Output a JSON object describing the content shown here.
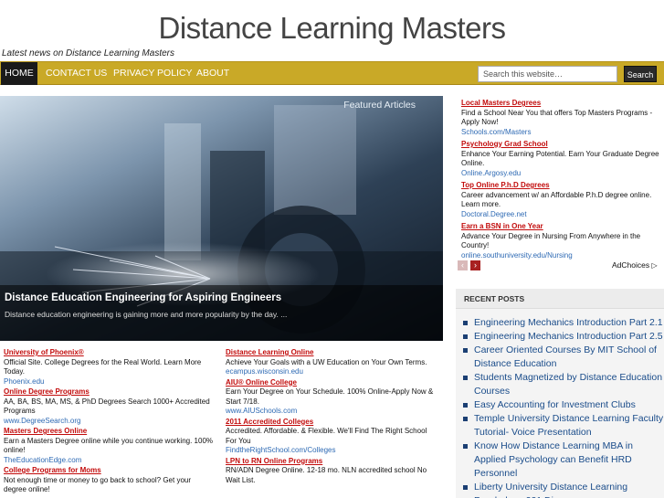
{
  "site": {
    "title": "Distance Learning Masters",
    "tagline": "Latest news on Distance Learning Masters"
  },
  "nav": {
    "items": [
      {
        "label": "HOME"
      },
      {
        "label": "CONTACT US"
      },
      {
        "label": "PRIVACY POLICY"
      },
      {
        "label": "ABOUT"
      }
    ],
    "search_placeholder": "Search this website…",
    "search_button": "Search"
  },
  "hero": {
    "label": "Featured Articles",
    "title": "Distance Education Engineering for Aspiring Engineers",
    "excerpt": "Distance education engineering is gaining more and more popularity by the day. ..."
  },
  "ads_left_col1": [
    {
      "title": "University of Phoenix®",
      "desc": "Official Site. College Degrees for the Real World. Learn More Today.",
      "url": "Phoenix.edu"
    },
    {
      "title": "Online Degree Programs",
      "desc": "AA, BA, BS, MA, MS, & PhD Degrees Search 1000+ Accredited Programs",
      "url": "www.DegreeSearch.org"
    },
    {
      "title": "Masters Degrees Online",
      "desc": "Earn a Masters Degree online while you continue working. 100% online!",
      "url": "TheEducationEdge.com"
    },
    {
      "title": "College Programs for Moms",
      "desc": "Not enough time or money to go back to school? Get your degree online!",
      "url": ""
    }
  ],
  "ads_left_col2": [
    {
      "title": "Distance Learning Online",
      "desc": "Achieve Your Goals with a UW Education on Your Own Terms.",
      "url": "ecampus.wisconsin.edu"
    },
    {
      "title": "AIU® Online College",
      "desc": "Earn Your Degree on Your Schedule. 100% Online-Apply Now & Start 7/18.",
      "url": "www.AIUSchools.com"
    },
    {
      "title": "2011 Accredited Colleges",
      "desc": "Accredited. Affordable. & Flexible. We'll Find The Right School For You",
      "url": "FindtheRightSchool.com/Colleges"
    },
    {
      "title": "LPN to RN Online Programs",
      "desc": "RN/ADN Degree Online. 12-18 mo. NLN accredited school No Wait List.",
      "url": ""
    }
  ],
  "ads_right": [
    {
      "title": "Local Masters Degrees",
      "desc": "Find a School Near You that offers Top Masters Programs - Apply Now!",
      "url": "Schools.com/Masters"
    },
    {
      "title": "Psychology Grad School",
      "desc": "Enhance Your Earning Potential. Earn Your Graduate Degree Online.",
      "url": "Online.Argosy.edu"
    },
    {
      "title": "Top Online P.h.D Degrees",
      "desc": "Career advancement w/ an Affordable P.h.D degree online. Learn more.",
      "url": "Doctoral.Degree.net"
    },
    {
      "title": "Earn a BSN in One Year",
      "desc": "Advance Your Degree in Nursing From Anywhere in the Country!",
      "url": "online.southuniversity.edu/Nursing"
    }
  ],
  "adchoices": {
    "label": "AdChoices",
    "icon": "▷",
    "prev": "‹",
    "next": "›"
  },
  "recent": {
    "heading": "RECENT POSTS",
    "items": [
      "Engineering Mechanics Introduction Part 2.1",
      "Engineering Mechanics Introduction Part 2.5",
      "Career Oriented Courses By MIT School of Distance Education",
      "Students Magnetized by Distance Education Courses",
      "Easy Accounting for Investment Clubs",
      "Temple University Distance Learning Faculty Tutorial- Voice Presentation",
      "Know How Distance Learning MBA in Applied Psychology can Benefit HRD Personnel",
      "Liberty University Distance Learning Psychology 221 Discs"
    ]
  }
}
